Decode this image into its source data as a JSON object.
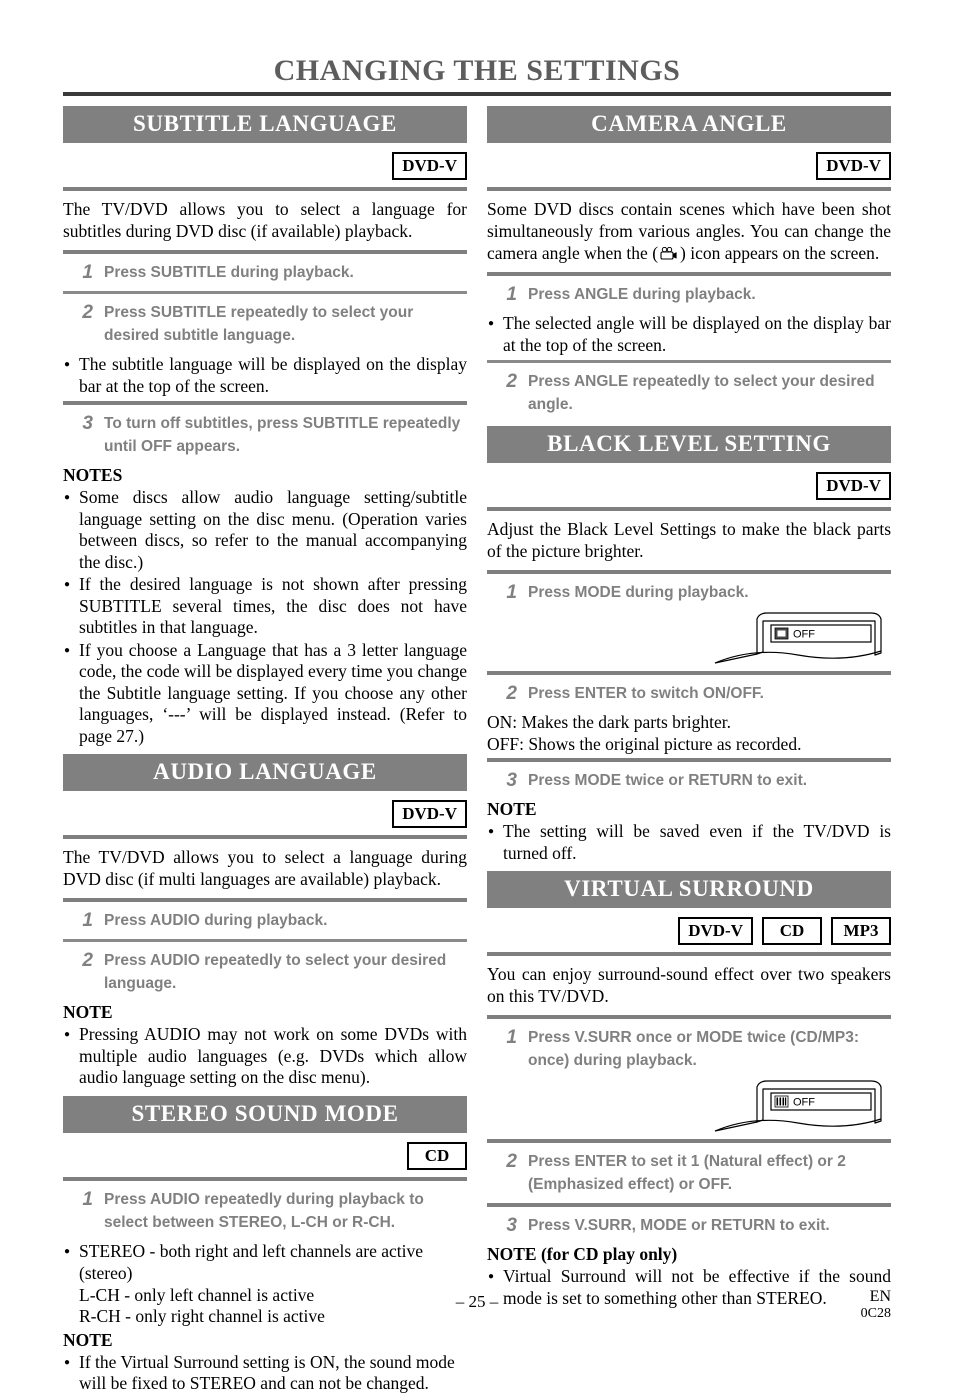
{
  "page": {
    "title": "CHANGING THE SETTINGS",
    "page_number": "– 25 –",
    "language_code": "EN",
    "doc_code": "0C28"
  },
  "colors": {
    "header_bar": "#808080",
    "step_text": "#808080",
    "title": "#5d5d5d",
    "rule": "#7f7f7f"
  },
  "left_column": {
    "subtitle_language": {
      "heading": "SUBTITLE LANGUAGE",
      "badges": [
        "DVD-V"
      ],
      "intro": "The TV/DVD allows you to select a language for subtitles during DVD disc (if available) playback.",
      "steps": [
        {
          "num": "1",
          "text": "Press SUBTITLE during playback."
        },
        {
          "num": "2",
          "text": "Press SUBTITLE repeatedly to select your desired subtitle language."
        },
        {
          "num": "3",
          "text": "To turn off subtitles, press SUBTITLE repeatedly until OFF appears."
        }
      ],
      "step2_bullet": "The subtitle language will be displayed on the display bar at the top of the screen.",
      "notes_heading": "NOTES",
      "notes": [
        "Some discs allow audio language setting/subtitle language setting on the disc menu. (Operation varies between discs, so refer to the manual accompanying the disc.)",
        "If the desired language is not shown after pressing SUBTITLE several times, the disc does not have subtitles in that language.",
        "If you choose a Language that has a 3 letter language code, the code will be displayed every time you change the Subtitle language setting. If you choose any other languages, ‘---’ will be displayed instead. (Refer to page 27.)"
      ]
    },
    "audio_language": {
      "heading": "AUDIO LANGUAGE",
      "badges": [
        "DVD-V"
      ],
      "intro": "The TV/DVD allows you to select a language during DVD disc (if multi languages are available) playback.",
      "steps": [
        {
          "num": "1",
          "text": "Press AUDIO during playback."
        },
        {
          "num": "2",
          "text": "Press AUDIO repeatedly to select your desired language."
        }
      ],
      "notes_heading": "NOTE",
      "notes": [
        "Pressing AUDIO may not work on some DVDs with multiple audio languages (e.g. DVDs which allow audio language setting on the disc menu)."
      ]
    },
    "stereo_sound_mode": {
      "heading": "STEREO SOUND MODE",
      "badges": [
        "CD"
      ],
      "steps": [
        {
          "num": "1",
          "text": "Press AUDIO repeatedly during playback to select between STEREO, L-CH or R-CH."
        }
      ],
      "channel_bullet": "STEREO - both right and left channels are active",
      "channel_lines": [
        "(stereo)",
        "L-CH - only left channel is active",
        "R-CH - only right channel is active"
      ],
      "notes_heading": "NOTE",
      "notes": [
        "If the Virtual Surround setting is ON, the sound mode will be fixed to STEREO and can not be changed."
      ]
    }
  },
  "right_column": {
    "camera_angle": {
      "heading": "CAMERA ANGLE",
      "badges": [
        "DVD-V"
      ],
      "intro_part1": "Some DVD discs contain scenes which have been shot simultaneously from various angles. You can change the camera angle when the (",
      "intro_part2": ") icon appears on the screen.",
      "icon_name": "camera-angle-icon",
      "steps": [
        {
          "num": "1",
          "text": "Press ANGLE during playback."
        },
        {
          "num": "2",
          "text": "Press ANGLE repeatedly to select your desired angle."
        }
      ],
      "step1_bullet": "The selected angle will be displayed on the display bar at the top of the screen."
    },
    "black_level_setting": {
      "heading": "BLACK LEVEL SETTING",
      "badges": [
        "DVD-V"
      ],
      "intro": "Adjust the Black Level Settings to make the black parts of the picture brighter.",
      "steps": [
        {
          "num": "1",
          "text": "Press MODE during playback."
        },
        {
          "num": "2",
          "text": "Press ENTER to switch ON/OFF."
        },
        {
          "num": "3",
          "text": "Press MODE twice or RETURN to exit."
        }
      ],
      "osd": {
        "label": "OFF",
        "icon_name": "black-level-osd-icon"
      },
      "on_line": "ON: Makes the dark parts brighter.",
      "off_line": "OFF: Shows the original picture as recorded.",
      "notes_heading": "NOTE",
      "notes": [
        "The setting will be saved even if the TV/DVD is turned off."
      ]
    },
    "virtual_surround": {
      "heading": "VIRTUAL SURROUND",
      "badges": [
        "DVD-V",
        "CD",
        "MP3"
      ],
      "intro": "You can enjoy surround-sound effect over two speakers on this TV/DVD.",
      "steps": [
        {
          "num": "1",
          "text": "Press V.SURR once or MODE twice (CD/MP3: once) during playback."
        },
        {
          "num": "2",
          "text": "Press ENTER to set it 1 (Natural effect) or 2 (Emphasized effect) or OFF."
        },
        {
          "num": "3",
          "text": "Press V.SURR, MODE or RETURN to exit."
        }
      ],
      "osd": {
        "label": "OFF",
        "icon_name": "virtual-surround-osd-icon"
      },
      "notes_heading": "NOTE (for CD play only)",
      "notes": [
        "Virtual Surround will not be effective if the sound mode is set to something other than STEREO."
      ]
    }
  }
}
